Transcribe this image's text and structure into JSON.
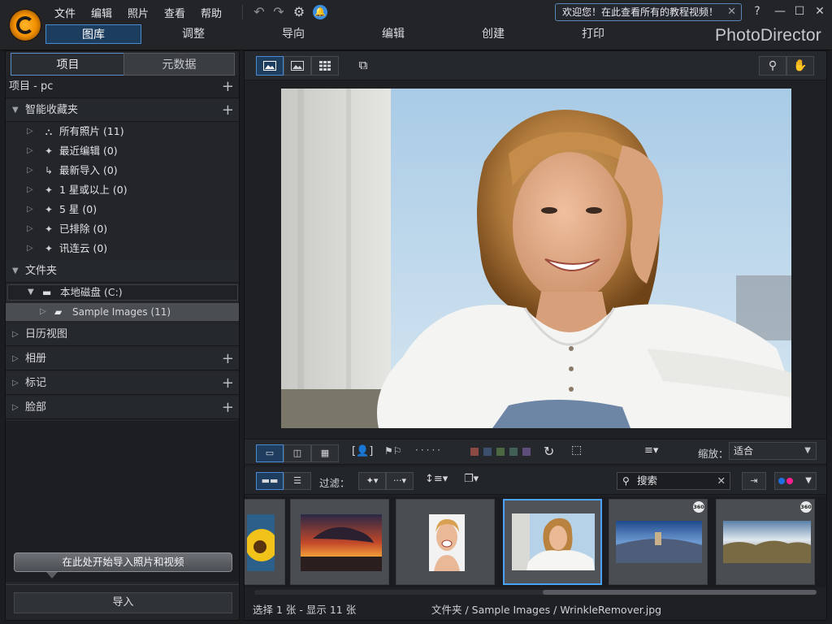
{
  "menu": {
    "items": [
      "文件",
      "编辑",
      "照片",
      "查看",
      "帮助"
    ]
  },
  "welcome_banner": {
    "text": "欢迎您！在此查看所有的教程视频！"
  },
  "window_buttons": {
    "help": "?",
    "minimize": "—",
    "maximize": "☐",
    "close": "✕"
  },
  "nav_tabs": [
    "图库",
    "调整",
    "导向",
    "编辑",
    "创建",
    "打印"
  ],
  "brand": "PhotoDirector",
  "left_panel": {
    "tabs": [
      "项目",
      "元数据"
    ],
    "project_header": "项目 - pc",
    "smart_collections": {
      "title": "智能收藏夹",
      "items": [
        {
          "label": "所有照片 (11)",
          "icon": "hierarchy-icon"
        },
        {
          "label": "最近编辑 (0)",
          "icon": "sparkle-icon"
        },
        {
          "label": "最新导入 (0)",
          "icon": "import-arrow-icon"
        },
        {
          "label": "1 星或以上 (0)",
          "icon": "sparkle-icon"
        },
        {
          "label": "5 星 (0)",
          "icon": "sparkle-icon"
        },
        {
          "label": "已排除 (0)",
          "icon": "sparkle-icon"
        },
        {
          "label": "讯连云 (0)",
          "icon": "sparkle-icon"
        }
      ]
    },
    "folders": {
      "title": "文件夹",
      "disk": "本地磁盘 (C:)",
      "subfolder": "Sample Images (11)"
    },
    "calendar": "日历视图",
    "albums": "相册",
    "tags": "标记",
    "faces": "脸部",
    "import_hint": "在此处开始导入照片和视频",
    "import_button": "导入"
  },
  "controls": {
    "zoom_label": "缩放：",
    "zoom_value": "适合",
    "filter_label": "过滤：",
    "search_placeholder": "搜索",
    "color_labels": [
      "#8a4a43",
      "#3d4f6e",
      "#4d6642",
      "#3f5f57",
      "#5e4d7a"
    ]
  },
  "status": {
    "selection": "选择 1 张 - 显示 11 张",
    "path": "文件夹 / Sample Images / WrinkleRemover.jpg"
  },
  "filmstrip": [
    {
      "kind": "sunflower"
    },
    {
      "kind": "sunset"
    },
    {
      "kind": "woman-smile"
    },
    {
      "kind": "woman-portrait",
      "selected": true
    },
    {
      "kind": "panorama-360",
      "badge": "360"
    },
    {
      "kind": "panorama-360",
      "badge": "360"
    }
  ],
  "colors": {
    "accent": "#4aa3ff",
    "brand": "#f29000"
  }
}
